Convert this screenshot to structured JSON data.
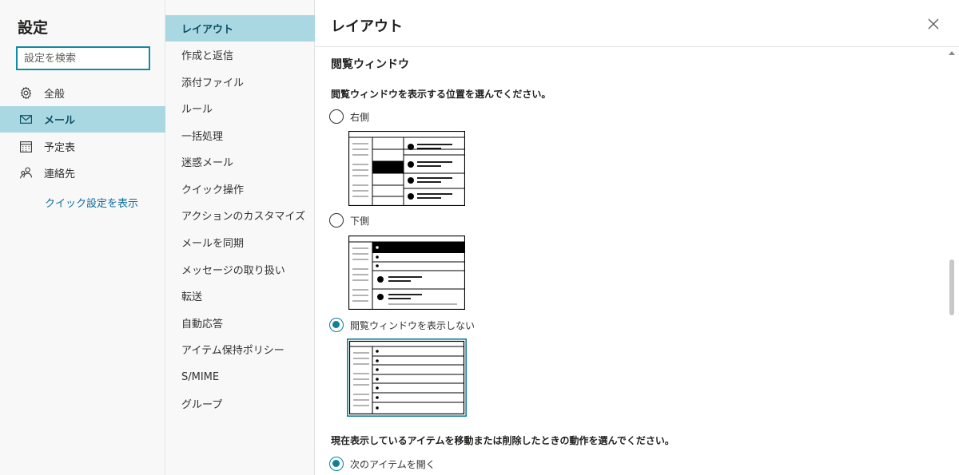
{
  "left_nav": {
    "title": "設定",
    "search_placeholder": "設定を検索",
    "items": [
      {
        "label": "全般",
        "icon": "gear-icon"
      },
      {
        "label": "メール",
        "icon": "mail-icon"
      },
      {
        "label": "予定表",
        "icon": "calendar-icon"
      },
      {
        "label": "連絡先",
        "icon": "people-icon"
      }
    ],
    "selected_index": 1,
    "quick_settings_link": "クイック設定を表示"
  },
  "mid_nav": {
    "items": [
      "レイアウト",
      "作成と返信",
      "添付ファイル",
      "ルール",
      "一括処理",
      "迷惑メール",
      "クイック操作",
      "アクションのカスタマイズ",
      "メールを同期",
      "メッセージの取り扱い",
      "転送",
      "自動応答",
      "アイテム保持ポリシー",
      "S/MIME",
      "グループ"
    ],
    "selected_index": 0
  },
  "content": {
    "title": "レイアウト",
    "section_title": "閲覧ウィンドウ",
    "question1": "閲覧ウィンドウを表示する位置を選んでください。",
    "reading_pane_options": [
      {
        "label": "右側",
        "checked": false
      },
      {
        "label": "下側",
        "checked": false
      },
      {
        "label": "閲覧ウィンドウを表示しない",
        "checked": true
      }
    ],
    "question2": "現在表示しているアイテムを移動または削除したときの動作を選んでください。",
    "after_move_options": [
      {
        "label": "次のアイテムを開く",
        "checked": true
      }
    ]
  },
  "colors": {
    "accent": "#0f7f9c",
    "selected_bg": "#a9d8e3",
    "nav_bg": "#f8f8f8"
  }
}
